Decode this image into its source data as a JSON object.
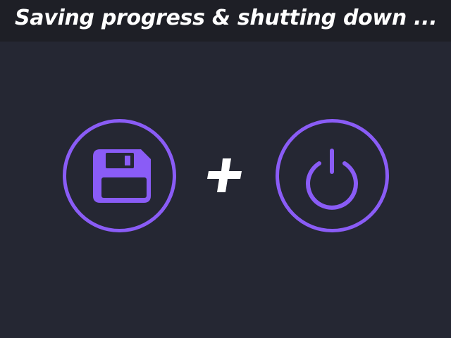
{
  "header": {
    "title": "Saving progress & shutting down ..."
  },
  "icons": {
    "save": "floppy-disk-icon",
    "combine": "plus-icon",
    "power": "power-icon"
  },
  "colors": {
    "background": "#252733",
    "title_bar": "#1e1f26",
    "accent": "#8a5cf6",
    "text": "#ffffff"
  }
}
